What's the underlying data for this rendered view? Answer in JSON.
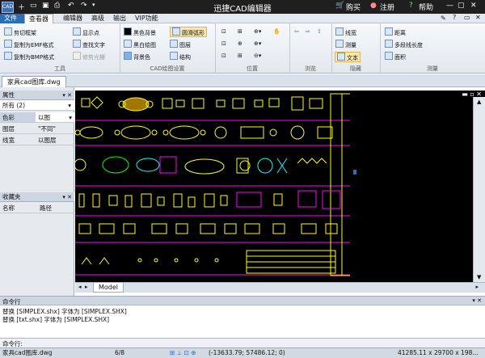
{
  "app": {
    "title": "迅捷CAD编辑器",
    "logo_text": "CAD",
    "buy_label": "购买",
    "register_label": "注册",
    "help_label": "帮助"
  },
  "menu": {
    "items": [
      "文件",
      "查看器",
      "编辑器",
      "高级",
      "输出",
      "VIP功能"
    ],
    "active": "查看器"
  },
  "ribbon": {
    "tools": {
      "title": "工具",
      "items": [
        "剪切框架",
        "复制为EMF格式",
        "复制为BMP格式",
        "显示点",
        "查找文字",
        "修剪光栅"
      ]
    },
    "drawing_settings": {
      "title": "CAD绘图设置",
      "items": [
        "黑色背景",
        "黑白绘图",
        "背景色",
        "圆滑弧形",
        "图层",
        "结构"
      ]
    },
    "position": {
      "title": "位置"
    },
    "browse": {
      "title": "浏览"
    },
    "hidden": {
      "title": "隐藏",
      "items": [
        "线宽",
        "测量",
        "文本"
      ]
    },
    "measure": {
      "title": "测量",
      "items": [
        "距离",
        "多段线长度",
        "面积"
      ]
    }
  },
  "document": {
    "tab_label": "家具cad图库.dwg",
    "model_tab": "Model"
  },
  "properties_panel": {
    "title": "属性",
    "filter": "所有 (2)",
    "rows": [
      {
        "name": "色彩",
        "value": "以图"
      },
      {
        "name": "图层",
        "value": "\"不同\""
      },
      {
        "name": "线宽",
        "value": "以图层"
      }
    ]
  },
  "favorites_panel": {
    "title": "收藏夹",
    "columns": [
      "名称",
      "路径"
    ]
  },
  "command": {
    "title": "命令行",
    "lines": [
      "替换 [SIMPLEX.shx] 字体为 [SIMPLEX.SHX]",
      "替换 [txt.shx] 字体为 [SIMPLEX.SHX]"
    ],
    "prompt": "命令行:"
  },
  "status": {
    "file": "家具cad图库.dwg",
    "page": "6/8",
    "coords": "(-13633.79; 57486.12; 0)",
    "size": "41285.11 x 29700 x 198..."
  },
  "colors": {
    "titlebar": "#1f1f1f",
    "accent": "#2d6db5",
    "canvas": "#000000",
    "cad_yellow": "#ffff00",
    "cad_magenta": "#ff00ff",
    "cad_green": "#00ff00",
    "cad_cyan": "#00ffff"
  }
}
